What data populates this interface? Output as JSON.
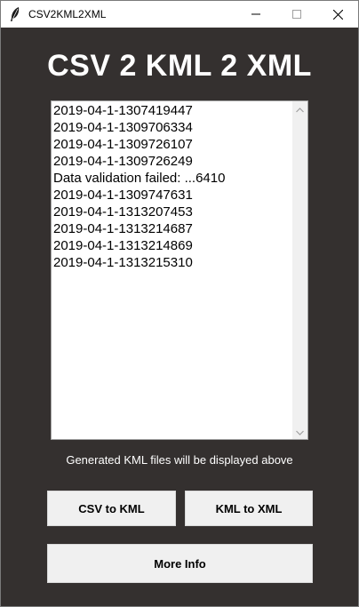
{
  "window": {
    "title": "CSV2KML2XML",
    "icon": "feather-icon",
    "controls": [
      "minimize-icon",
      "maximize-icon",
      "close-icon"
    ]
  },
  "heading": "CSV 2 KML 2 XML",
  "file_list": {
    "items": [
      "2019-04-1-1307419447",
      "2019-04-1-1309706334",
      "2019-04-1-1309726107",
      "2019-04-1-1309726249",
      "Data validation failed: ...6410",
      "2019-04-1-1309747631",
      "2019-04-1-1313207453",
      "2019-04-1-1313214687",
      "2019-04-1-1313214869",
      "2019-04-1-1313215310"
    ]
  },
  "caption": "Generated KML files will be displayed above",
  "buttons": {
    "csv_to_kml": "CSV to KML",
    "kml_to_xml": "KML to XML",
    "more_info": "More Info"
  },
  "colors": {
    "background": "#34302f",
    "heading_text": "#ffffff",
    "button_face": "#f0f0f0"
  }
}
